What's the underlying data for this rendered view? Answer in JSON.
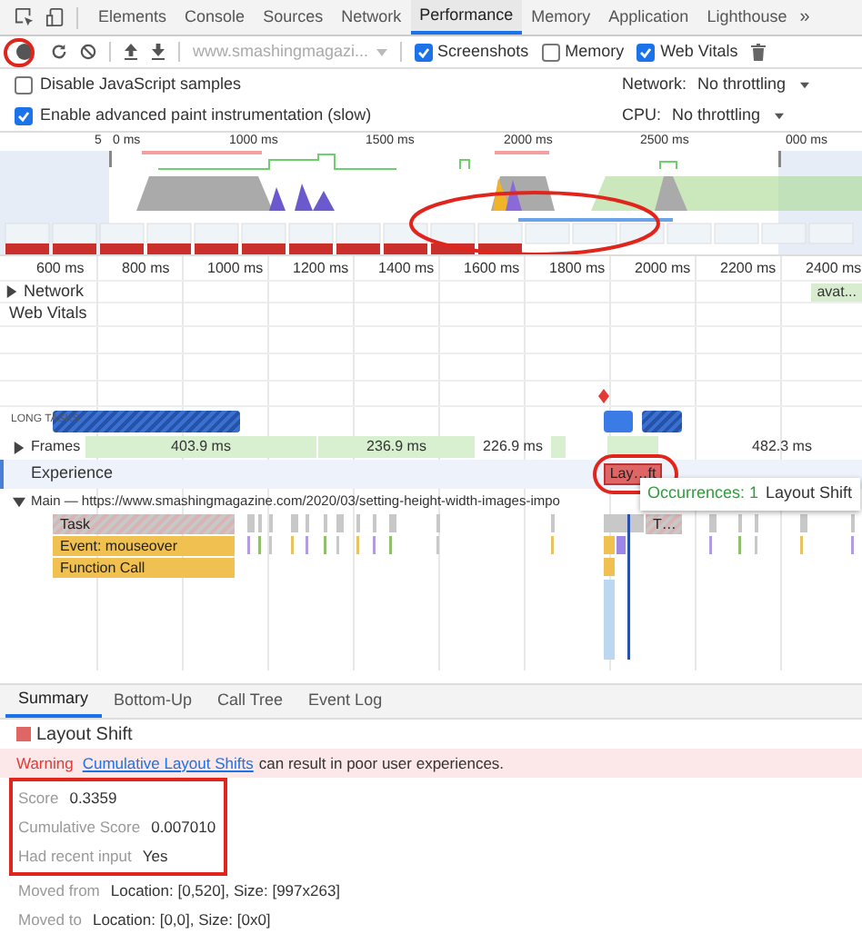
{
  "tabs": [
    {
      "label": "Elements",
      "selected": false
    },
    {
      "label": "Console",
      "selected": false
    },
    {
      "label": "Sources",
      "selected": false
    },
    {
      "label": "Network",
      "selected": false
    },
    {
      "label": "Performance",
      "selected": true
    },
    {
      "label": "Memory",
      "selected": false
    },
    {
      "label": "Application",
      "selected": false
    },
    {
      "label": "Lighthouse",
      "selected": false
    }
  ],
  "more_tabs": "»",
  "toolbar": {
    "url": "www.smashingmagazi...",
    "options": [
      {
        "label": "Screenshots",
        "checked": true
      },
      {
        "label": "Memory",
        "checked": false
      },
      {
        "label": "Web Vitals",
        "checked": true
      }
    ]
  },
  "settings": [
    {
      "label": "Disable JavaScript samples",
      "checked": false,
      "throttle_label": "Network:",
      "throttle_value": "No throttling"
    },
    {
      "label": "Enable advanced paint instrumentation (slow)",
      "checked": true,
      "throttle_label": "CPU:",
      "throttle_value": "No throttling"
    }
  ],
  "overview": {
    "ticks": [
      "5",
      "0 ms",
      "1000 ms",
      "1500 ms",
      "2000 ms",
      "2500 ms",
      "000 ms"
    ]
  },
  "ruler": [
    "600 ms",
    "800 ms",
    "1000 ms",
    "1200 ms",
    "1400 ms",
    "1600 ms",
    "1800 ms",
    "2000 ms",
    "2200 ms",
    "2400 ms"
  ],
  "tracks": {
    "network": {
      "label": "Network",
      "expanded": false,
      "request": "avat..."
    },
    "web_vitals": "Web Vitals",
    "long_tasks": "LONG TASKS",
    "frames": {
      "label": "Frames",
      "expanded": false,
      "durations": [
        "403.9 ms",
        "236.9 ms",
        "226.9 ms",
        "482.3 ms"
      ]
    },
    "experience": {
      "label": "Experience",
      "event": "Lay…ft"
    },
    "tooltip": {
      "count": "Occurrences: 1",
      "name": "Layout Shift"
    },
    "main": {
      "label": "Main — https://www.smashingmagazine.com/2020/03/setting-height-width-images-impo",
      "expanded": true,
      "events": [
        {
          "label": "Task",
          "kind": "task"
        },
        {
          "label": "Event: mouseover",
          "kind": "event"
        },
        {
          "label": "Function Call",
          "kind": "event"
        },
        {
          "label": "T…",
          "kind": "task"
        }
      ]
    }
  },
  "details": {
    "tabs": [
      {
        "label": "Summary",
        "selected": true
      },
      {
        "label": "Bottom-Up",
        "selected": false
      },
      {
        "label": "Call Tree",
        "selected": false
      },
      {
        "label": "Event Log",
        "selected": false
      }
    ],
    "title": "Layout Shift",
    "warning": {
      "label": "Warning",
      "link": "Cumulative Layout Shifts",
      "text": "can result in poor user experiences."
    },
    "highlighted_fields": [
      {
        "label": "Score",
        "value": "0.3359"
      },
      {
        "label": "Cumulative Score",
        "value": "0.007010"
      },
      {
        "label": "Had recent input",
        "value": "Yes"
      }
    ],
    "fields": [
      {
        "label": "Moved from",
        "value": "Location: [0,520], Size: [997x263]"
      },
      {
        "label": "Moved to",
        "value": "Location: [0,0], Size: [0x0]"
      }
    ]
  }
}
